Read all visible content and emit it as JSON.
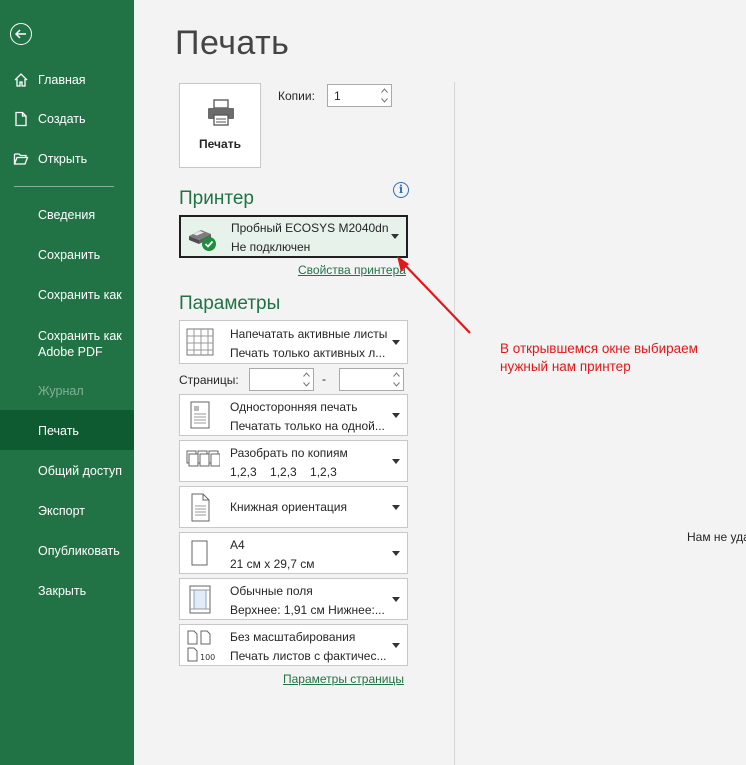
{
  "sidebar": {
    "items": [
      {
        "label": "Главная",
        "icon": "home-icon"
      },
      {
        "label": "Создать",
        "icon": "new-doc-icon"
      },
      {
        "label": "Открыть",
        "icon": "folder-icon"
      },
      {
        "label": "Сведения"
      },
      {
        "label": "Сохранить"
      },
      {
        "label": "Сохранить как"
      },
      {
        "label": "Сохранить как Adobe PDF"
      },
      {
        "label": "Журнал",
        "disabled": true
      },
      {
        "label": "Печать",
        "active": true
      },
      {
        "label": "Общий доступ"
      },
      {
        "label": "Экспорт"
      },
      {
        "label": "Опубликовать"
      },
      {
        "label": "Закрыть"
      }
    ],
    "colors": {
      "background": "#217346",
      "active": "#0e5b31"
    }
  },
  "main": {
    "title": "Печать",
    "print_button_label": "Печать",
    "copies_label": "Копии:",
    "copies_value": "1"
  },
  "printer": {
    "heading": "Принтер",
    "name": "Пробный ECOSYS M2040dn",
    "status": "Не подключен",
    "properties_link": "Свойства принтера"
  },
  "settings": {
    "heading": "Параметры",
    "pages_label": "Страницы:",
    "pages_dash": "-",
    "options": [
      {
        "line1": "Напечатать активные листы",
        "line2": "Печать только активных л..."
      },
      {
        "line1": "Односторонняя печать",
        "line2": "Печатать только на одной..."
      },
      {
        "line1": "Разобрать по копиям",
        "line2": "1,2,3    1,2,3    1,2,3"
      },
      {
        "line1": "Книжная ориентация",
        "line2": ""
      },
      {
        "line1": "А4",
        "line2": "21 см x 29,7 см"
      },
      {
        "line1": "Обычные поля",
        "line2": "Верхнее: 1,91 см Нижнее:..."
      },
      {
        "line1": "Без масштабирования",
        "line2": "Печать листов с фактичес..."
      }
    ],
    "page_setup_link": "Параметры страницы"
  },
  "annotation": {
    "line1": "В открывшемся окне выбираем",
    "line2": "нужный нам принтер",
    "color": "#e0181a"
  },
  "preview": {
    "note": "Нам не уда"
  }
}
